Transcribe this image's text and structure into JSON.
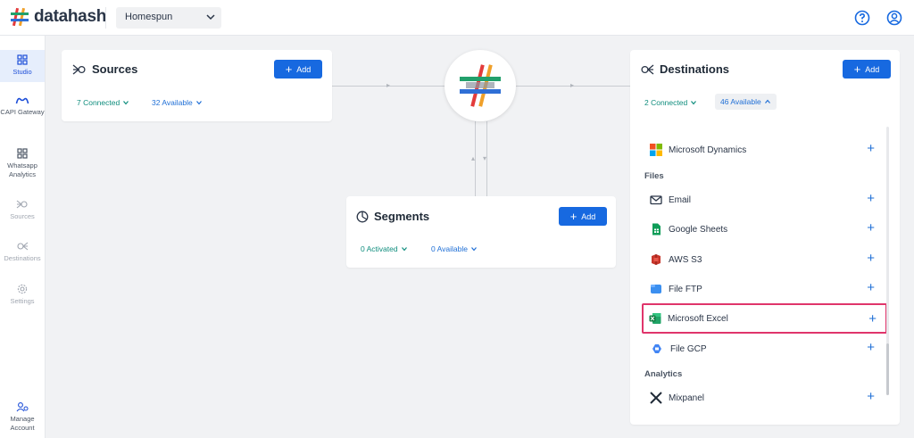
{
  "brand": {
    "name": "datahash"
  },
  "workspace": {
    "name": "Homespun"
  },
  "sidebar": {
    "items": [
      {
        "label": "Studio",
        "active": true
      },
      {
        "label": "CAPI Gateway"
      },
      {
        "label": "Whatsapp Analytics"
      },
      {
        "label": "Sources"
      },
      {
        "label": "Destinations"
      },
      {
        "label": "Settings"
      },
      {
        "label": "Manage Account"
      }
    ]
  },
  "sources": {
    "title": "Sources",
    "add_label": "Add",
    "connected": "7 Connected",
    "available": "32 Available"
  },
  "segments": {
    "title": "Segments",
    "add_label": "Add",
    "activated": "0 Activated",
    "available": "0 Available"
  },
  "destinations": {
    "title": "Destinations",
    "add_label": "Add",
    "connected": "2 Connected",
    "available": "46 Available",
    "items": [
      {
        "label": "Microsoft Dynamics",
        "icon": "microsoft-dynamics-icon"
      },
      {
        "group": "Files"
      },
      {
        "label": "Email",
        "icon": "email-icon"
      },
      {
        "label": "Google Sheets",
        "icon": "google-sheets-icon"
      },
      {
        "label": "AWS S3",
        "icon": "aws-s3-icon"
      },
      {
        "label": "File FTP",
        "icon": "file-ftp-icon"
      },
      {
        "label": "Microsoft Excel",
        "icon": "microsoft-excel-icon",
        "highlighted": true
      },
      {
        "label": "File GCP",
        "icon": "file-gcp-icon"
      },
      {
        "group": "Analytics"
      },
      {
        "label": "Mixpanel",
        "icon": "mixpanel-icon"
      }
    ]
  },
  "colors": {
    "accent": "#1769e0",
    "connected_text": "#0f8d7d",
    "available_text": "#1f6fd6",
    "highlight": "#e0356b"
  }
}
